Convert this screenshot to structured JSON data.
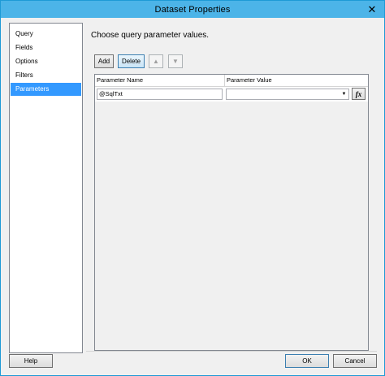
{
  "window": {
    "title": "Dataset Properties",
    "close_glyph": "✕"
  },
  "nav": {
    "items": [
      {
        "label": "Query"
      },
      {
        "label": "Fields"
      },
      {
        "label": "Options"
      },
      {
        "label": "Filters"
      },
      {
        "label": "Parameters",
        "selected": true
      }
    ]
  },
  "main": {
    "prompt": "Choose query parameter values.",
    "toolbar": {
      "add_label": "Add",
      "delete_label": "Delete",
      "move_up_icon": "arrow-up-icon",
      "move_down_icon": "arrow-down-icon"
    },
    "grid": {
      "columns": [
        "Parameter Name",
        "Parameter Value"
      ],
      "rows": [
        {
          "name": "@SqlTxt",
          "value": ""
        }
      ],
      "expression_button_label": "fx"
    }
  },
  "footer": {
    "help_label": "Help",
    "ok_label": "OK",
    "cancel_label": "Cancel"
  },
  "colors": {
    "titlebar": "#4cb4e8",
    "selection": "#3399ff",
    "border": "#1e9ad6"
  }
}
